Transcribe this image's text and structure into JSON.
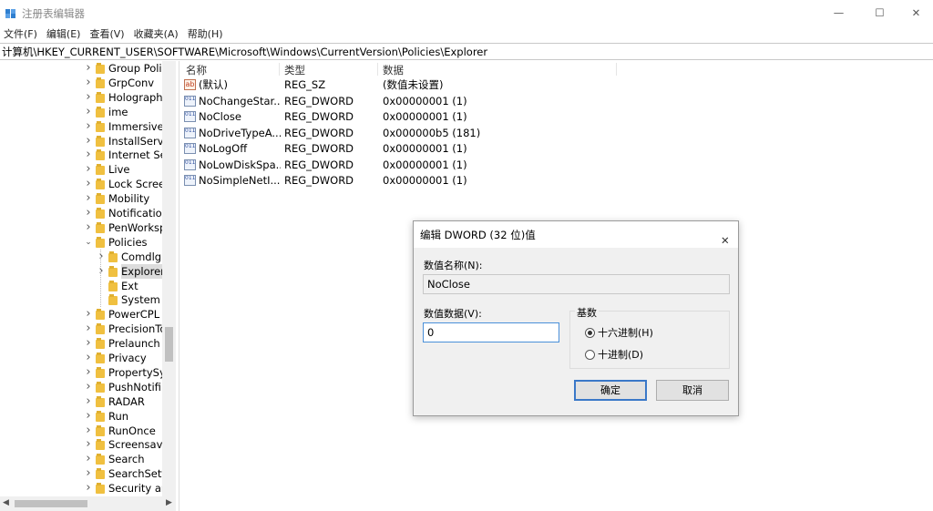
{
  "window": {
    "title": "注册表编辑器",
    "minimize_glyph": "—",
    "maximize_glyph": "☐",
    "close_glyph": "✕"
  },
  "menu": [
    "文件(F)",
    "编辑(E)",
    "查看(V)",
    "收藏夹(A)",
    "帮助(H)"
  ],
  "address": "计算机\\HKEY_CURRENT_USER\\SOFTWARE\\Microsoft\\Windows\\CurrentVersion\\Policies\\Explorer",
  "tree": [
    {
      "label": "Group Poli",
      "expanded": false,
      "level": 0
    },
    {
      "label": "GrpConv",
      "expanded": false,
      "level": 0
    },
    {
      "label": "Holograph",
      "expanded": false,
      "level": 0
    },
    {
      "label": "ime",
      "expanded": false,
      "level": 0
    },
    {
      "label": "Immersive",
      "expanded": false,
      "level": 0
    },
    {
      "label": "InstallServi",
      "expanded": false,
      "level": 0
    },
    {
      "label": "Internet Se",
      "expanded": false,
      "level": 0
    },
    {
      "label": "Live",
      "expanded": false,
      "level": 0
    },
    {
      "label": "Lock Scree",
      "expanded": false,
      "level": 0
    },
    {
      "label": "Mobility",
      "expanded": false,
      "level": 0
    },
    {
      "label": "Notificatio",
      "expanded": false,
      "level": 0
    },
    {
      "label": "PenWorksp",
      "expanded": false,
      "level": 0
    },
    {
      "label": "Policies",
      "expanded": true,
      "level": 0
    },
    {
      "label": "Comdlg",
      "expanded": false,
      "level": 1
    },
    {
      "label": "Explorer",
      "expanded": false,
      "level": 1,
      "selected": true
    },
    {
      "label": "Ext",
      "expanded": null,
      "level": 1
    },
    {
      "label": "System",
      "expanded": null,
      "level": 1
    },
    {
      "label": "PowerCPL",
      "expanded": false,
      "level": 0
    },
    {
      "label": "PrecisionTo",
      "expanded": false,
      "level": 0
    },
    {
      "label": "Prelaunch",
      "expanded": false,
      "level": 0
    },
    {
      "label": "Privacy",
      "expanded": false,
      "level": 0
    },
    {
      "label": "PropertySy",
      "expanded": false,
      "level": 0
    },
    {
      "label": "PushNotifi",
      "expanded": false,
      "level": 0
    },
    {
      "label": "RADAR",
      "expanded": false,
      "level": 0
    },
    {
      "label": "Run",
      "expanded": false,
      "level": 0
    },
    {
      "label": "RunOnce",
      "expanded": false,
      "level": 0
    },
    {
      "label": "Screensave",
      "expanded": false,
      "level": 0
    },
    {
      "label": "Search",
      "expanded": false,
      "level": 0
    },
    {
      "label": "SearchSett",
      "expanded": false,
      "level": 0
    },
    {
      "label": "Security ar",
      "expanded": false,
      "level": 0
    }
  ],
  "list": {
    "headers": {
      "name": "名称",
      "type": "类型",
      "data": "数据"
    },
    "rows": [
      {
        "icon": "string-value-icon",
        "name": "(默认)",
        "type": "REG_SZ",
        "data": "(数值未设置)"
      },
      {
        "icon": "dword-value-icon",
        "name": "NoChangeStar...",
        "type": "REG_DWORD",
        "data": "0x00000001 (1)"
      },
      {
        "icon": "dword-value-icon",
        "name": "NoClose",
        "type": "REG_DWORD",
        "data": "0x00000001 (1)"
      },
      {
        "icon": "dword-value-icon",
        "name": "NoDriveTypeA...",
        "type": "REG_DWORD",
        "data": "0x000000b5 (181)"
      },
      {
        "icon": "dword-value-icon",
        "name": "NoLogOff",
        "type": "REG_DWORD",
        "data": "0x00000001 (1)"
      },
      {
        "icon": "dword-value-icon",
        "name": "NoLowDiskSpa...",
        "type": "REG_DWORD",
        "data": "0x00000001 (1)"
      },
      {
        "icon": "dword-value-icon",
        "name": "NoSimpleNetI...",
        "type": "REG_DWORD",
        "data": "0x00000001 (1)"
      }
    ]
  },
  "dialog": {
    "title": "编辑 DWORD (32 位)值",
    "value_name_label": "数值名称(N):",
    "value_name": "NoClose",
    "value_data_label": "数值数据(V):",
    "value_data": "0",
    "base_label": "基数",
    "hex_label": "十六进制(H)",
    "dec_label": "十进制(D)",
    "base_selected": "hex",
    "ok_label": "确定",
    "cancel_label": "取消"
  }
}
